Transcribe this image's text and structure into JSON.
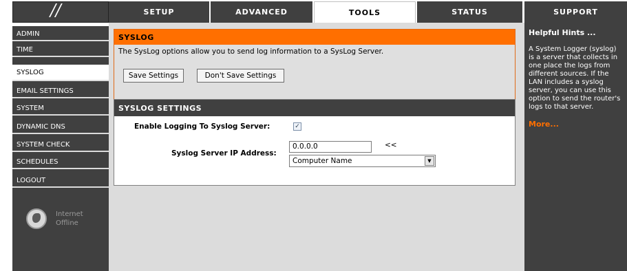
{
  "nav": {
    "tabs": [
      {
        "label": "SETUP"
      },
      {
        "label": "ADVANCED"
      },
      {
        "label": "TOOLS"
      },
      {
        "label": "STATUS"
      },
      {
        "label": "SUPPORT"
      }
    ],
    "active_tab": "TOOLS"
  },
  "sidebar": {
    "items": [
      {
        "label": "ADMIN"
      },
      {
        "label": "TIME"
      },
      {
        "label": "SYSLOG"
      },
      {
        "label": "EMAIL SETTINGS"
      },
      {
        "label": "SYSTEM"
      },
      {
        "label": "DYNAMIC DNS"
      },
      {
        "label": "SYSTEM CHECK"
      },
      {
        "label": "SCHEDULES"
      },
      {
        "label": "LOGOUT"
      }
    ],
    "active_item": "SYSLOG",
    "status": {
      "icon": "globe-icon",
      "line1": "Internet",
      "line2": "Offline"
    }
  },
  "syslog": {
    "title": "SYSLOG",
    "intro": "The SysLog options allow you to send log information to a SysLog Server.",
    "save_label": "Save Settings",
    "dont_save_label": "Don't Save Settings"
  },
  "settings": {
    "title": "SYSLOG SETTINGS",
    "enable_label": "Enable Logging To Syslog Server:",
    "enable_checked": true,
    "ip_label": "Syslog Server IP Address:",
    "ip_value": "0.0.0.0",
    "copy_arrow": "<<",
    "computer_select_value": "Computer Name"
  },
  "help": {
    "title": "Helpful Hints ...",
    "body": "A System Logger (syslog) is a server that collects in one place the logs from different sources. If the LAN includes a syslog server, you can use this option to send the router's logs to that server.",
    "more": "More..."
  },
  "colors": {
    "accent_orange": "#ff6f00",
    "dark_gray": "#404040",
    "panel_gray": "#dcdcdc"
  }
}
